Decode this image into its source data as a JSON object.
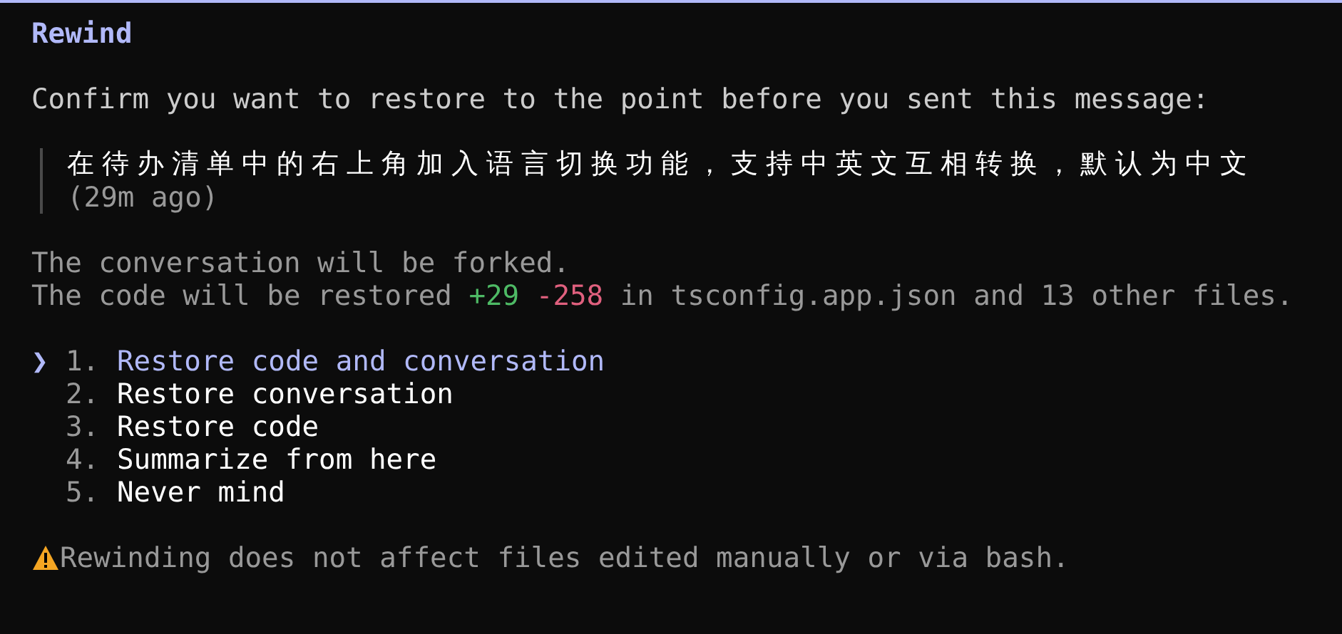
{
  "title": "Rewind",
  "prompt": "Confirm you want to restore to the point before you sent this message:",
  "quote": {
    "message": "在待办清单中的右上角加入语言切换功能，支持中英文互相转换，默认为中文",
    "time": "(29m ago)"
  },
  "notes": {
    "fork": "The conversation will be forked.",
    "code": {
      "prefix": "The code will be restored",
      "added": "+29",
      "removed": "-258",
      "suffix": "in tsconfig.app.json and 13 other files."
    }
  },
  "selection_marker": "❯",
  "options": [
    {
      "number": "1.",
      "label": "Restore code and conversation",
      "selected": true
    },
    {
      "number": "2.",
      "label": "Restore conversation",
      "selected": false
    },
    {
      "number": "3.",
      "label": "Restore code",
      "selected": false
    },
    {
      "number": "4.",
      "label": "Summarize from here",
      "selected": false
    },
    {
      "number": "5.",
      "label": "Never mind",
      "selected": false
    }
  ],
  "warning": "Rewinding does not affect files edited manually or via bash."
}
